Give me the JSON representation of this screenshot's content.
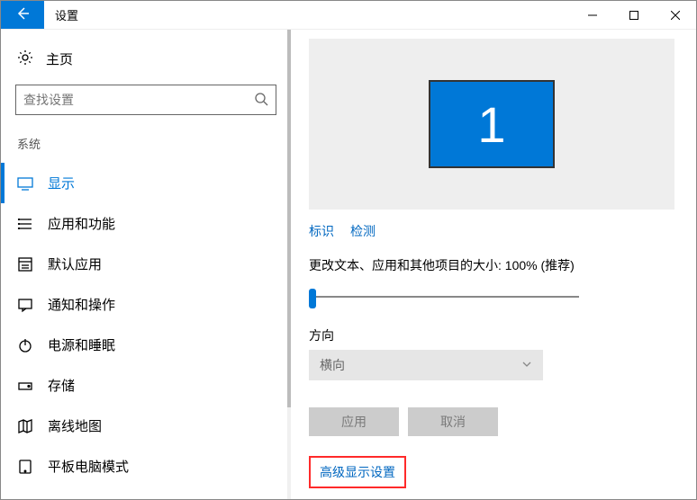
{
  "titlebar": {
    "title": "设置"
  },
  "sidebar": {
    "home_label": "主页",
    "search_placeholder": "查找设置",
    "section_label": "系统",
    "items": [
      {
        "label": "显示",
        "icon": "display",
        "active": true
      },
      {
        "label": "应用和功能",
        "icon": "apps",
        "active": false
      },
      {
        "label": "默认应用",
        "icon": "defaults",
        "active": false
      },
      {
        "label": "通知和操作",
        "icon": "notifications",
        "active": false
      },
      {
        "label": "电源和睡眠",
        "icon": "power",
        "active": false
      },
      {
        "label": "存储",
        "icon": "storage",
        "active": false
      },
      {
        "label": "离线地图",
        "icon": "maps",
        "active": false
      },
      {
        "label": "平板电脑模式",
        "icon": "tablet",
        "active": false
      }
    ]
  },
  "main": {
    "monitor_number": "1",
    "link_identify": "标识",
    "link_detect": "检测",
    "scale_label": "更改文本、应用和其他项目的大小: 100% (推荐)",
    "direction_label": "方向",
    "direction_value": "横向",
    "btn_apply": "应用",
    "btn_cancel": "取消",
    "advanced_link": "高级显示设置"
  }
}
